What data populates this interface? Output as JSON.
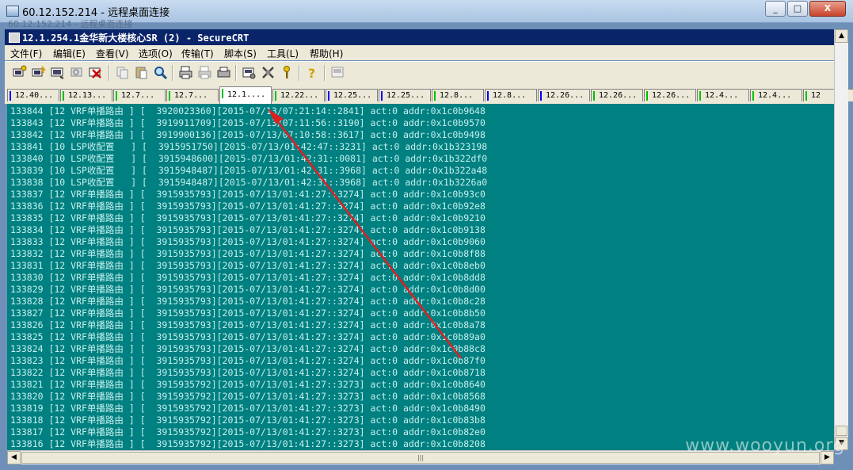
{
  "rdp": {
    "title": "60.12.152.214 - 远程桌面连接",
    "ghost_text": "60.12.152.214 - 远程桌面连接"
  },
  "window_buttons": {
    "minimize": "_",
    "restore": "□",
    "close": "X"
  },
  "crt": {
    "title": "12.1.254.1金华新大楼核心SR (2) - SecureCRT"
  },
  "menu": [
    "文件(F)",
    "编辑(E)",
    "查看(V)",
    "选项(O)",
    "传输(T)",
    "脚本(S)",
    "工具(L)",
    "帮助(H)"
  ],
  "toolbar_icons": [
    "connect-icon",
    "quick-connect-icon",
    "connect-tab-icon",
    "reconnect-icon",
    "disconnect-icon",
    "copy-icon",
    "paste-icon",
    "find-icon",
    "print-icon",
    "print-selection-icon",
    "printer-setup-icon",
    "session-options-icon",
    "global-options-icon",
    "keymap-icon",
    "help-icon",
    "sftp-icon"
  ],
  "tabs": [
    {
      "label": "12.40...",
      "mark": "#0000ff"
    },
    {
      "label": "12.13...",
      "mark": "#00c000"
    },
    {
      "label": "12.7...",
      "mark": "#00c000"
    },
    {
      "label": "12.7...",
      "mark": "#00c000"
    },
    {
      "label": "12.1....",
      "mark": "#00c000",
      "active": true
    },
    {
      "label": "12.22...",
      "mark": "#00c000"
    },
    {
      "label": "12.25...",
      "mark": "#0000ff"
    },
    {
      "label": "12.25...",
      "mark": "#0000ff"
    },
    {
      "label": "12.8...",
      "mark": "#00c000"
    },
    {
      "label": "12.8...",
      "mark": "#0000ff"
    },
    {
      "label": "12.26...",
      "mark": "#0000ff"
    },
    {
      "label": "12.26...",
      "mark": "#00c000"
    },
    {
      "label": "12.26...",
      "mark": "#00c000"
    },
    {
      "label": "12.4...",
      "mark": "#00c000"
    },
    {
      "label": "12.4...",
      "mark": "#00c000"
    },
    {
      "label": "12",
      "mark": "#00c000"
    }
  ],
  "terminal_lines": [
    "133844 [12 VRF单播路由 ] [  3920023360][2015-07/13/07:21:14::2841] act:0 addr:0x1c0b9648",
    "133843 [12 VRF单播路由 ] [  3919911709][2015-07/13/07:11:56::3190] act:0 addr:0x1c0b9570",
    "133842 [12 VRF单播路由 ] [  3919900136][2015-07/13/07:10:58::3617] act:0 addr:0x1c0b9498",
    "133841 [10 LSP收配置   ] [  3915951750][2015-07/13/01:42:47::3231] act:0 addr:0x1b323198",
    "133840 [10 LSP收配置   ] [  3915948600][2015-07/13/01:42:31::0081] act:0 addr:0x1b322df0",
    "133839 [10 LSP收配置   ] [  3915948487][2015-07/13/01:42:31::3968] act:0 addr:0x1b322a48",
    "133838 [10 LSP收配置   ] [  3915948487][2015-07/13/01:42:31::3968] act:0 addr:0x1b3226a0",
    "133837 [12 VRF单播路由 ] [  3915935793][2015-07/13/01:41:27::3274] act:0 addr:0x1c0b93c0",
    "133836 [12 VRF单播路由 ] [  3915935793][2015-07/13/01:41:27::3274] act:0 addr:0x1c0b92e8",
    "133835 [12 VRF单播路由 ] [  3915935793][2015-07/13/01:41:27::3274] act:0 addr:0x1c0b9210",
    "133834 [12 VRF单播路由 ] [  3915935793][2015-07/13/01:41:27::3274] act:0 addr:0x1c0b9138",
    "133833 [12 VRF单播路由 ] [  3915935793][2015-07/13/01:41:27::3274] act:0 addr:0x1c0b9060",
    "133832 [12 VRF单播路由 ] [  3915935793][2015-07/13/01:41:27::3274] act:0 addr:0x1c0b8f88",
    "133831 [12 VRF单播路由 ] [  3915935793][2015-07/13/01:41:27::3274] act:0 addr:0x1c0b8eb0",
    "133830 [12 VRF单播路由 ] [  3915935793][2015-07/13/01:41:27::3274] act:0 addr:0x1c0b8dd8",
    "133829 [12 VRF单播路由 ] [  3915935793][2015-07/13/01:41:27::3274] act:0 addr:0x1c0b8d00",
    "133828 [12 VRF单播路由 ] [  3915935793][2015-07/13/01:41:27::3274] act:0 addr:0x1c0b8c28",
    "133827 [12 VRF单播路由 ] [  3915935793][2015-07/13/01:41:27::3274] act:0 addr:0x1c0b8b50",
    "133826 [12 VRF单播路由 ] [  3915935793][2015-07/13/01:41:27::3274] act:0 addr:0x1c0b8a78",
    "133825 [12 VRF单播路由 ] [  3915935793][2015-07/13/01:41:27::3274] act:0 addr:0x1c0b89a0",
    "133824 [12 VRF单播路由 ] [  3915935793][2015-07/13/01:41:27::3274] act:0 addr:0x1c0b88c8",
    "133823 [12 VRF单播路由 ] [  3915935793][2015-07/13/01:41:27::3274] act:0 addr:0x1c0b87f0",
    "133822 [12 VRF单播路由 ] [  3915935793][2015-07/13/01:41:27::3274] act:0 addr:0x1c0b8718",
    "133821 [12 VRF单播路由 ] [  3915935792][2015-07/13/01:41:27::3273] act:0 addr:0x1c0b8640",
    "133820 [12 VRF单播路由 ] [  3915935792][2015-07/13/01:41:27::3273] act:0 addr:0x1c0b8568",
    "133819 [12 VRF单播路由 ] [  3915935792][2015-07/13/01:41:27::3273] act:0 addr:0x1c0b8490",
    "133818 [12 VRF单播路由 ] [  3915935792][2015-07/13/01:41:27::3273] act:0 addr:0x1c0b83b8",
    "133817 [12 VRF单播路由 ] [  3915935792][2015-07/13/01:41:27::3273] act:0 addr:0x1c0b82e0",
    "133816 [12 VRF单播路由 ] [  3915935792][2015-07/13/01:41:27::3273] act:0 addr:0x1c0b8208"
  ],
  "watermark": "www.wooyun.org",
  "colors": {
    "terminal_bg": "#008080",
    "terminal_fg": "#c6efef",
    "arrow": "#e02020",
    "crt_titlebar": "#0a246a"
  }
}
